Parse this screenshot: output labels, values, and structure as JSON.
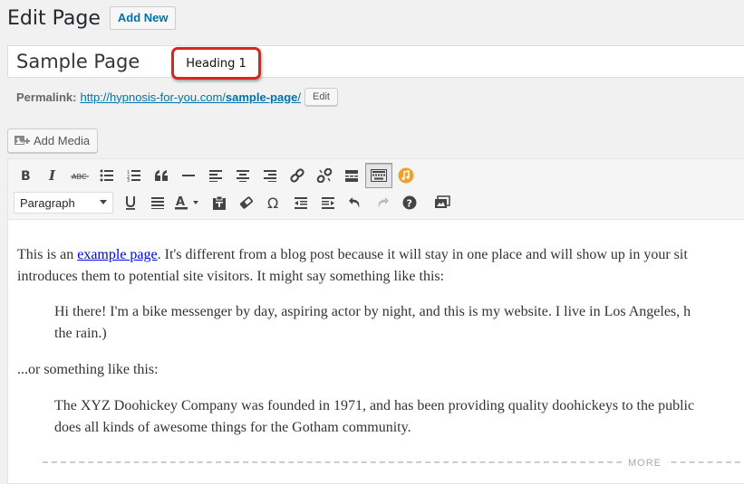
{
  "header": {
    "title": "Edit Page",
    "add_new": "Add New"
  },
  "post": {
    "title_value": "Sample Page"
  },
  "callout": {
    "text": "Heading 1"
  },
  "permalink": {
    "label": "Permalink:",
    "url_base": "http://hypnosis-for-you.com/",
    "slug": "sample-page",
    "url_tail": "/",
    "edit_label": "Edit"
  },
  "media": {
    "add_media": "Add Media"
  },
  "toolbar": {
    "format_select": "Paragraph",
    "row1_icons": [
      "bold-icon",
      "italic-icon",
      "strikethrough-icon",
      "bullet-list-icon",
      "numbered-list-icon",
      "blockquote-icon",
      "horizontal-line-icon",
      "align-left-icon",
      "align-center-icon",
      "align-right-icon",
      "insert-link-icon",
      "remove-link-icon",
      "read-more-icon",
      "toolbar-toggle-icon",
      "audio-icon"
    ],
    "row2_icons": [
      "underline-icon",
      "justify-icon",
      "text-color-icon",
      "paste-as-text-icon",
      "clear-formatting-icon",
      "special-character-icon",
      "outdent-icon",
      "indent-icon",
      "undo-icon",
      "redo-icon",
      "help-icon",
      "distraction-free-icon"
    ],
    "abc": "ABC",
    "omega": "Ω"
  },
  "content": {
    "p1_line1_before": "This is an ",
    "p1_link": "example page",
    "p1_line1_after": ". It's different from a blog post because it will stay in one place and will show up in your sit",
    "p1_line2": "introduces them to potential site visitors. It might say something like this:",
    "quote1_line1": "Hi there! I'm a bike messenger by day, aspiring actor by night, and this is my website. I live in Los Angeles, h",
    "quote1_line2": "the rain.)",
    "p2": "...or something like this:",
    "quote2_line1": "The XYZ Doohickey Company was founded in 1971, and has been providing quality doohickeys to the public",
    "quote2_line2": "does all kinds of awesome things for the Gotham community.",
    "more_tag": "MORE"
  },
  "colors": {
    "link": "#0073aa",
    "callout_border": "#d9261c",
    "audio_icon": "#f0a030"
  }
}
